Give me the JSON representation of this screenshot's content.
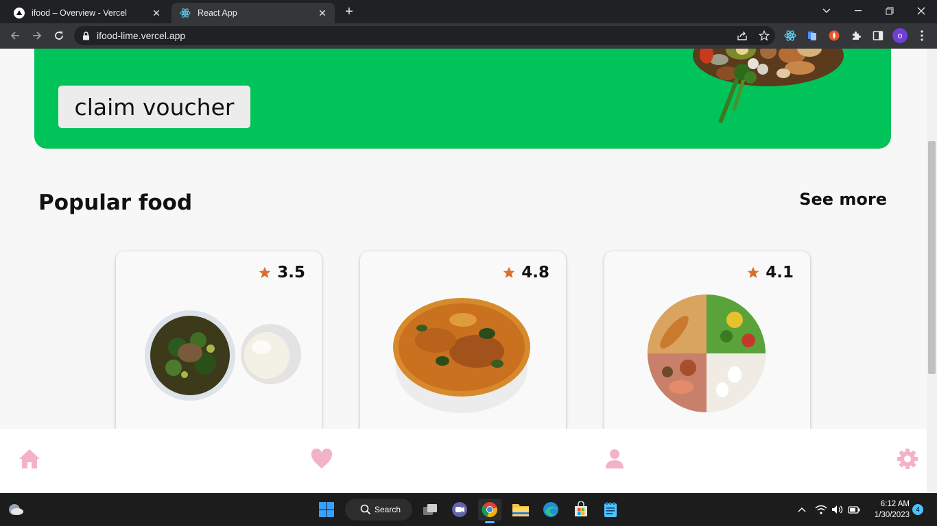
{
  "browser": {
    "tabs": [
      {
        "title": "ifood – Overview - Vercel",
        "active": false
      },
      {
        "title": "React App",
        "active": true
      }
    ],
    "url": "ifood-lime.vercel.app",
    "profile_initial": "o"
  },
  "page": {
    "voucher_label": "claim voucher",
    "section_title": "Popular food",
    "see_more_label": "See more",
    "foods": [
      {
        "rating": "3.5",
        "image": "okra-soup-with-fufu"
      },
      {
        "rating": "4.8",
        "image": "pepper-soup-bowl"
      },
      {
        "rating": "4.1",
        "image": "balanced-diet-plate"
      }
    ],
    "nav_icons": [
      "home-icon",
      "heart-icon",
      "user-icon",
      "settings-icon"
    ],
    "accent_color": "#00c35a",
    "nav_icon_color": "#f3b3c7",
    "star_color": "#d9712e"
  },
  "taskbar": {
    "search_label": "Search",
    "time": "6:12 AM",
    "date": "1/30/2023",
    "notification_count": "4"
  }
}
